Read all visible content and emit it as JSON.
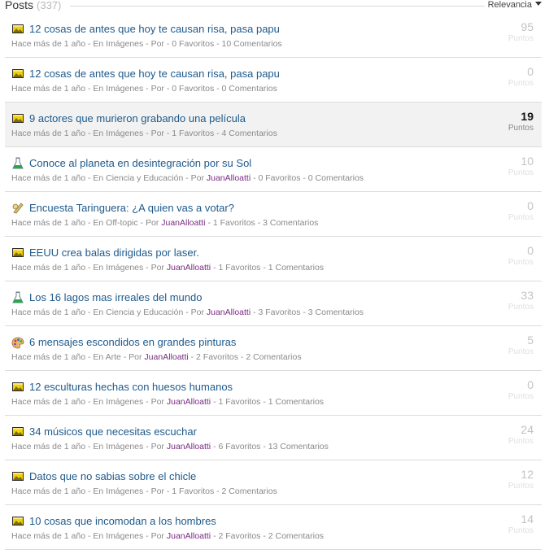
{
  "header": {
    "title": "Posts",
    "count": "(337)",
    "sort_label": "Relevancia"
  },
  "posts": [
    {
      "icon": "imagenes-icon",
      "title": "12 cosas de antes que hoy te causan risa, pasa papu",
      "meta_pre": "Hace más de 1 año - En Imágenes - Por ",
      "author": "",
      "meta_post": " - 0 Favoritos - 10 Comentarios",
      "score": "95",
      "score_label": "Puntos",
      "highlight": false,
      "hot": false
    },
    {
      "icon": "imagenes-icon",
      "title": "12 cosas de antes que hoy te causan risa, pasa papu",
      "meta_pre": "Hace más de 1 año - En Imágenes - Por ",
      "author": "",
      "meta_post": " - 0 Favoritos - 0 Comentarios",
      "score": "0",
      "score_label": "Puntos",
      "highlight": false,
      "hot": false
    },
    {
      "icon": "imagenes-icon",
      "title": "9 actores que murieron grabando una película",
      "meta_pre": "Hace más de 1 año - En Imágenes - Por ",
      "author": "",
      "meta_post": " - 1 Favoritos - 4 Comentarios",
      "score": "19",
      "score_label": "Puntos",
      "highlight": true,
      "hot": true
    },
    {
      "icon": "ciencia-icon",
      "title": "Conoce al planeta en desintegración por su Sol",
      "meta_pre": "Hace más de 1 año - En Ciencia y Educación - Por ",
      "author": "JuanAlloatti",
      "meta_post": " - 0 Favoritos - 0 Comentarios",
      "score": "10",
      "score_label": "Puntos",
      "highlight": false,
      "hot": false
    },
    {
      "icon": "offtopic-icon",
      "title": "Encuesta Taringuera: ¿A quien vas a votar?",
      "meta_pre": "Hace más de 1 año - En Off-topic - Por ",
      "author": "JuanAlloatti",
      "meta_post": " - 1 Favoritos - 3 Comentarios",
      "score": "0",
      "score_label": "Puntos",
      "highlight": false,
      "hot": false
    },
    {
      "icon": "imagenes-icon",
      "title": "EEUU crea balas dirigidas por laser.",
      "meta_pre": "Hace más de 1 año - En Imágenes - Por ",
      "author": "JuanAlloatti",
      "meta_post": " - 1 Favoritos - 1 Comentarios",
      "score": "0",
      "score_label": "Puntos",
      "highlight": false,
      "hot": false
    },
    {
      "icon": "ciencia-icon",
      "title": "Los 16 lagos mas irreales del mundo",
      "meta_pre": "Hace más de 1 año - En Ciencia y Educación - Por ",
      "author": "JuanAlloatti",
      "meta_post": " - 3 Favoritos - 3 Comentarios",
      "score": "33",
      "score_label": "Puntos",
      "highlight": false,
      "hot": false
    },
    {
      "icon": "arte-icon",
      "title": "6 mensajes escondidos en grandes pinturas",
      "meta_pre": "Hace más de 1 año - En Arte - Por ",
      "author": "JuanAlloatti",
      "meta_post": " - 2 Favoritos - 2 Comentarios",
      "score": "5",
      "score_label": "Puntos",
      "highlight": false,
      "hot": false
    },
    {
      "icon": "imagenes-icon",
      "title": "12 esculturas hechas con huesos humanos",
      "meta_pre": "Hace más de 1 año - En Imágenes - Por ",
      "author": "JuanAlloatti",
      "meta_post": " - 1 Favoritos - 1 Comentarios",
      "score": "0",
      "score_label": "Puntos",
      "highlight": false,
      "hot": false
    },
    {
      "icon": "imagenes-icon",
      "title": "34 músicos que necesitas escuchar",
      "meta_pre": "Hace más de 1 año - En Imágenes - Por ",
      "author": "JuanAlloatti",
      "meta_post": " - 6 Favoritos - 13 Comentarios",
      "score": "24",
      "score_label": "Puntos",
      "highlight": false,
      "hot": false
    },
    {
      "icon": "imagenes-icon",
      "title": "Datos que no sabias sobre el chicle",
      "meta_pre": "Hace más de 1 año - En Imágenes - Por ",
      "author": "",
      "meta_post": " - 1 Favoritos - 2 Comentarios",
      "score": "12",
      "score_label": "Puntos",
      "highlight": false,
      "hot": false
    },
    {
      "icon": "imagenes-icon",
      "title": "10 cosas que incomodan a los hombres",
      "meta_pre": "Hace más de 1 año - En Imágenes - Por ",
      "author": "JuanAlloatti",
      "meta_post": " - 2 Favoritos - 2 Comentarios",
      "score": "14",
      "score_label": "Puntos",
      "highlight": false,
      "hot": false
    }
  ]
}
